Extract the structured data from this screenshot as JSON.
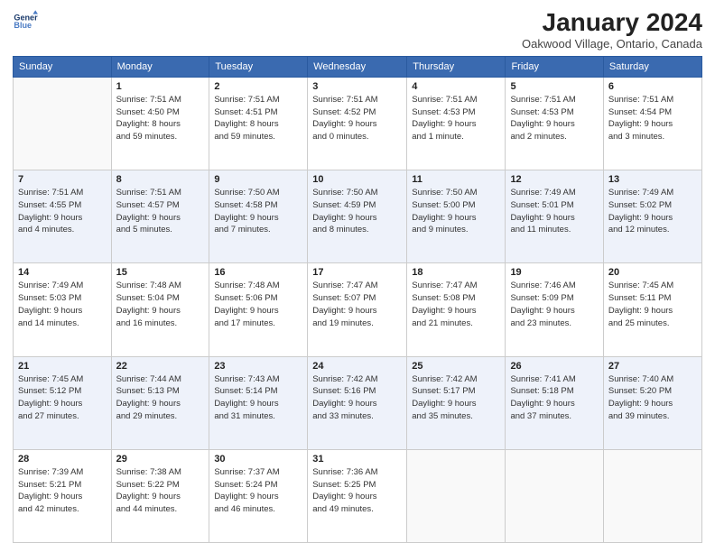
{
  "header": {
    "logo_line1": "General",
    "logo_line2": "Blue",
    "month_title": "January 2024",
    "location": "Oakwood Village, Ontario, Canada"
  },
  "days_of_week": [
    "Sunday",
    "Monday",
    "Tuesday",
    "Wednesday",
    "Thursday",
    "Friday",
    "Saturday"
  ],
  "weeks": [
    [
      {
        "day": "",
        "info": ""
      },
      {
        "day": "1",
        "info": "Sunrise: 7:51 AM\nSunset: 4:50 PM\nDaylight: 8 hours\nand 59 minutes."
      },
      {
        "day": "2",
        "info": "Sunrise: 7:51 AM\nSunset: 4:51 PM\nDaylight: 8 hours\nand 59 minutes."
      },
      {
        "day": "3",
        "info": "Sunrise: 7:51 AM\nSunset: 4:52 PM\nDaylight: 9 hours\nand 0 minutes."
      },
      {
        "day": "4",
        "info": "Sunrise: 7:51 AM\nSunset: 4:53 PM\nDaylight: 9 hours\nand 1 minute."
      },
      {
        "day": "5",
        "info": "Sunrise: 7:51 AM\nSunset: 4:53 PM\nDaylight: 9 hours\nand 2 minutes."
      },
      {
        "day": "6",
        "info": "Sunrise: 7:51 AM\nSunset: 4:54 PM\nDaylight: 9 hours\nand 3 minutes."
      }
    ],
    [
      {
        "day": "7",
        "info": "Sunrise: 7:51 AM\nSunset: 4:55 PM\nDaylight: 9 hours\nand 4 minutes."
      },
      {
        "day": "8",
        "info": "Sunrise: 7:51 AM\nSunset: 4:57 PM\nDaylight: 9 hours\nand 5 minutes."
      },
      {
        "day": "9",
        "info": "Sunrise: 7:50 AM\nSunset: 4:58 PM\nDaylight: 9 hours\nand 7 minutes."
      },
      {
        "day": "10",
        "info": "Sunrise: 7:50 AM\nSunset: 4:59 PM\nDaylight: 9 hours\nand 8 minutes."
      },
      {
        "day": "11",
        "info": "Sunrise: 7:50 AM\nSunset: 5:00 PM\nDaylight: 9 hours\nand 9 minutes."
      },
      {
        "day": "12",
        "info": "Sunrise: 7:49 AM\nSunset: 5:01 PM\nDaylight: 9 hours\nand 11 minutes."
      },
      {
        "day": "13",
        "info": "Sunrise: 7:49 AM\nSunset: 5:02 PM\nDaylight: 9 hours\nand 12 minutes."
      }
    ],
    [
      {
        "day": "14",
        "info": "Sunrise: 7:49 AM\nSunset: 5:03 PM\nDaylight: 9 hours\nand 14 minutes."
      },
      {
        "day": "15",
        "info": "Sunrise: 7:48 AM\nSunset: 5:04 PM\nDaylight: 9 hours\nand 16 minutes."
      },
      {
        "day": "16",
        "info": "Sunrise: 7:48 AM\nSunset: 5:06 PM\nDaylight: 9 hours\nand 17 minutes."
      },
      {
        "day": "17",
        "info": "Sunrise: 7:47 AM\nSunset: 5:07 PM\nDaylight: 9 hours\nand 19 minutes."
      },
      {
        "day": "18",
        "info": "Sunrise: 7:47 AM\nSunset: 5:08 PM\nDaylight: 9 hours\nand 21 minutes."
      },
      {
        "day": "19",
        "info": "Sunrise: 7:46 AM\nSunset: 5:09 PM\nDaylight: 9 hours\nand 23 minutes."
      },
      {
        "day": "20",
        "info": "Sunrise: 7:45 AM\nSunset: 5:11 PM\nDaylight: 9 hours\nand 25 minutes."
      }
    ],
    [
      {
        "day": "21",
        "info": "Sunrise: 7:45 AM\nSunset: 5:12 PM\nDaylight: 9 hours\nand 27 minutes."
      },
      {
        "day": "22",
        "info": "Sunrise: 7:44 AM\nSunset: 5:13 PM\nDaylight: 9 hours\nand 29 minutes."
      },
      {
        "day": "23",
        "info": "Sunrise: 7:43 AM\nSunset: 5:14 PM\nDaylight: 9 hours\nand 31 minutes."
      },
      {
        "day": "24",
        "info": "Sunrise: 7:42 AM\nSunset: 5:16 PM\nDaylight: 9 hours\nand 33 minutes."
      },
      {
        "day": "25",
        "info": "Sunrise: 7:42 AM\nSunset: 5:17 PM\nDaylight: 9 hours\nand 35 minutes."
      },
      {
        "day": "26",
        "info": "Sunrise: 7:41 AM\nSunset: 5:18 PM\nDaylight: 9 hours\nand 37 minutes."
      },
      {
        "day": "27",
        "info": "Sunrise: 7:40 AM\nSunset: 5:20 PM\nDaylight: 9 hours\nand 39 minutes."
      }
    ],
    [
      {
        "day": "28",
        "info": "Sunrise: 7:39 AM\nSunset: 5:21 PM\nDaylight: 9 hours\nand 42 minutes."
      },
      {
        "day": "29",
        "info": "Sunrise: 7:38 AM\nSunset: 5:22 PM\nDaylight: 9 hours\nand 44 minutes."
      },
      {
        "day": "30",
        "info": "Sunrise: 7:37 AM\nSunset: 5:24 PM\nDaylight: 9 hours\nand 46 minutes."
      },
      {
        "day": "31",
        "info": "Sunrise: 7:36 AM\nSunset: 5:25 PM\nDaylight: 9 hours\nand 49 minutes."
      },
      {
        "day": "",
        "info": ""
      },
      {
        "day": "",
        "info": ""
      },
      {
        "day": "",
        "info": ""
      }
    ]
  ]
}
